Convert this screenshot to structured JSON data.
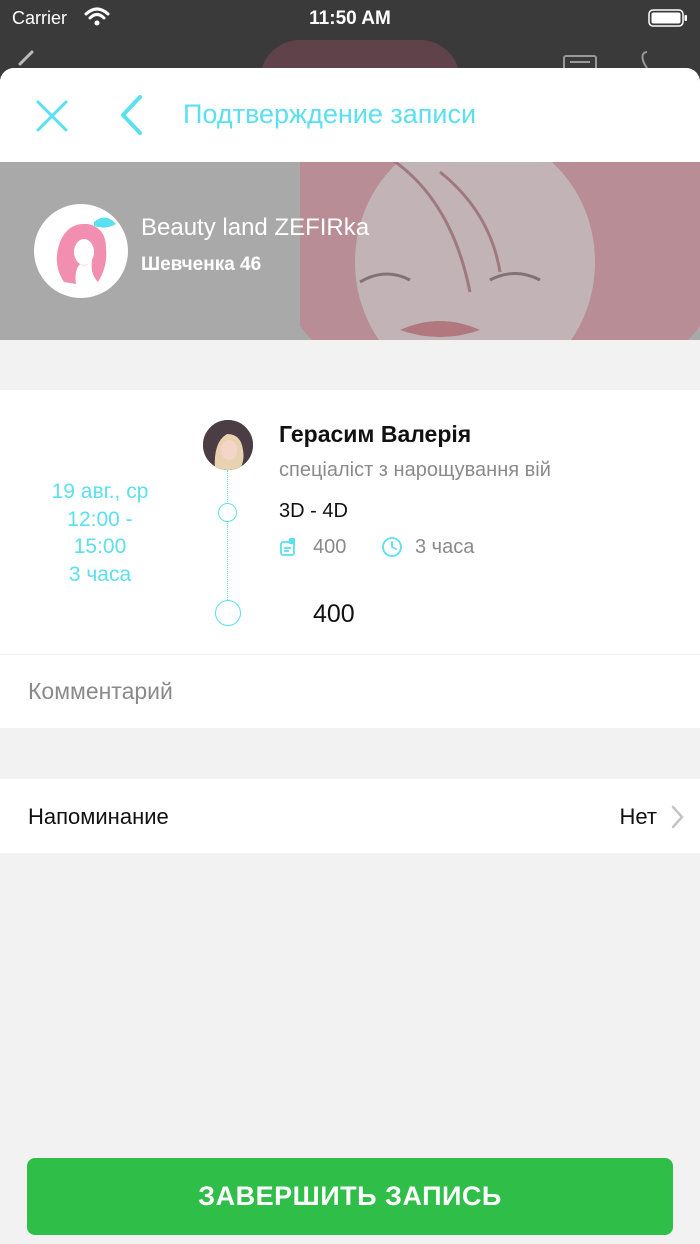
{
  "status_bar": {
    "carrier": "Carrier",
    "time": "11:50 AM"
  },
  "nav": {
    "title": "Подтверждение записи"
  },
  "salon": {
    "name": "Beauty land ZEFIRka",
    "address": "Шевченка 46"
  },
  "booking": {
    "date_line1": "19 авг., ср",
    "date_line2": "12:00 -",
    "date_line3": "15:00",
    "date_line4": "3 часа",
    "specialist_name": "Герасим Валерія",
    "specialist_role": "спеціаліст з нарощування вій",
    "service_name": "3D - 4D",
    "service_price": "400",
    "service_duration": "3 часа",
    "total_price": "400"
  },
  "comment": {
    "placeholder": "Комментарий"
  },
  "reminder": {
    "label": "Напоминание",
    "value": "Нет"
  },
  "footer": {
    "finish_label": "ЗАВЕРШИТЬ ЗАПИСЬ"
  },
  "colors": {
    "accent": "#5ae0ee",
    "button": "#2fbf48",
    "background": "#f2f2f2"
  }
}
